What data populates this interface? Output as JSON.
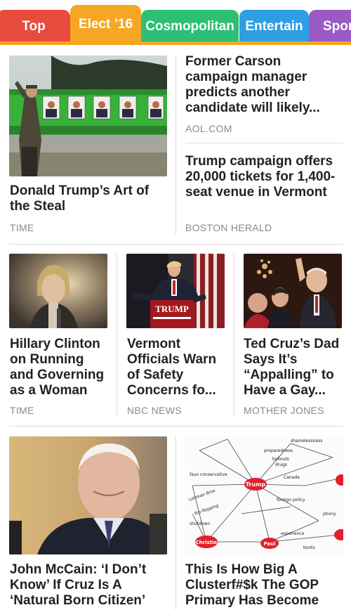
{
  "tabs": [
    {
      "label": "Top",
      "color": "#e84a3d"
    },
    {
      "label": "Elect ’16",
      "color": "#f6a623"
    },
    {
      "label": "Cosmopolitan",
      "color": "#2dbf74"
    },
    {
      "label": "Entertain",
      "color": "#2e9ee3"
    },
    {
      "label": "Sports",
      "color": "#9b59c4"
    }
  ],
  "active_tab": "Elect ’16",
  "accent_color": "#f6a623",
  "articles": [
    {
      "headline": "Donald Trump’s Art of the Steal",
      "source": "TIME",
      "image": "trump-bus-photo"
    },
    {
      "headline": "Former Carson campaign manager predicts another candidate will likely...",
      "source": "AOL.COM"
    },
    {
      "headline": "Trump campaign offers 20,000 tickets for 1,400-seat venue in Vermont",
      "source": "BOSTON HERALD"
    },
    {
      "headline": "Hillary Clinton on Running and Governing as a Woman",
      "source": "TIME",
      "image": "clinton-photo"
    },
    {
      "headline": "Vermont Officials Warn of Safety Concerns fo...",
      "source": "NBC NEWS",
      "image": "trump-podium-photo",
      "podium_text": "TRUMP"
    },
    {
      "headline": "Ted Cruz’s Dad Says It’s “Appalling” to Have a Gay...",
      "source": "MOTHER JONES",
      "image": "cruz-photo"
    },
    {
      "headline": "John McCain: ‘I Don’t Know’ If Cruz Is A ‘Natural Born Citizen’",
      "source": "",
      "image": "mccain-photo"
    },
    {
      "headline": "This Is How Big A Clusterf#$k The GOP Primary Has Become",
      "source": "",
      "image": "gop-diagram"
    }
  ],
  "diagram": {
    "nodes": [
      "Trump",
      "Christie",
      "Paul"
    ],
    "labels": [
      "shamelessness",
      "preparedness",
      "ballouts",
      "drugs",
      "faux conservative",
      "Lehman Bros",
      "flip-flopping",
      "shutdown",
      "Canada",
      "foreign policy",
      "experience",
      "boots",
      "phony",
      "Trump"
    ]
  }
}
